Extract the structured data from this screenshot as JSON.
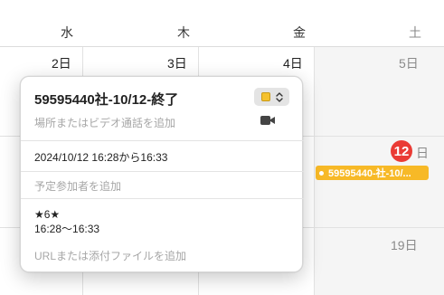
{
  "calendar": {
    "weekdays": {
      "wed": "水",
      "thu": "木",
      "fri": "金",
      "sat": "土"
    },
    "days": {
      "wed_row1": "2日",
      "thu_row1": "3日",
      "fri_row1": "4日",
      "sat_row1": "5日",
      "sat_row2_num": "12",
      "sat_row2_suffix": "日",
      "sat_row3": "19日"
    },
    "today_color": "#ea3b35",
    "event_chip": {
      "label": "59595440-社-10/...",
      "color": "#f7b927"
    }
  },
  "popover": {
    "title": "59595440社-10/12-終了",
    "color_value": "#f5c12e",
    "location_placeholder": "場所またはビデオ通話を追加",
    "datetime": "2024/10/12 16:28から16:33",
    "invitees_placeholder": "予定参加者を追加",
    "notes_line1": "★6★",
    "notes_line2": "16:28～16:33",
    "url_placeholder": "URLまたは添付ファイルを追加",
    "icons": {
      "video": "video-camera-icon",
      "chevron": "chevron-up-down-icon"
    }
  }
}
